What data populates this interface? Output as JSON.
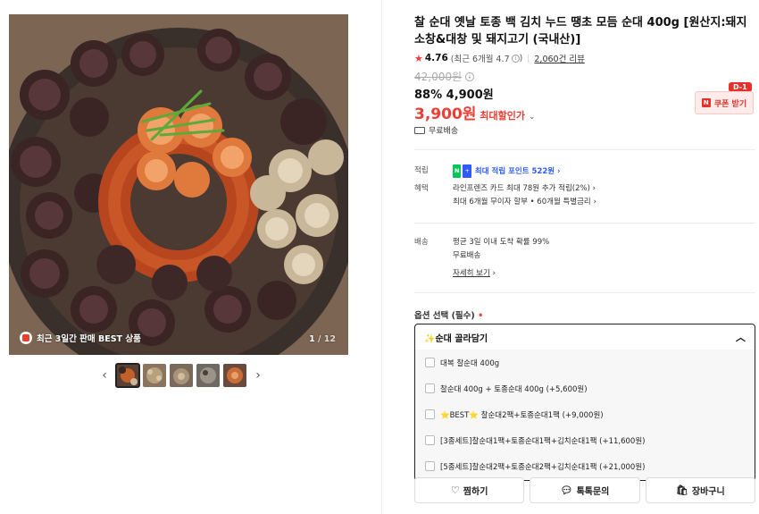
{
  "gallery": {
    "badge_text": "최근 3일간 판매 BEST 상품",
    "counter_current": "1",
    "counter_total": "/ 12",
    "prev_arrow": "‹",
    "next_arrow": "›"
  },
  "product": {
    "title": "찰 순대 옛날 토종 백 김치 누드 땡초 모듬 순대 400g [원산지:돼지소창&대창 및 돼지고기 (국내산)]",
    "rating_score": "4.76",
    "rating_recent": "(최근 6개월 4.7",
    "rating_close": ")",
    "reviews": "2,060건 리뷰",
    "original_price": "42,000원",
    "discount_price": "88% 4,900원",
    "max_price": "3,900원",
    "max_label": "최대할인가",
    "coupon_label": "쿠폰 받기",
    "coupon_badge": "D-1",
    "shipping": "무료배송"
  },
  "benefits": {
    "points_key": "적립",
    "points_value": "최대 적립 포인트 522원",
    "perks_key": "혜택",
    "perk_1": "라인프렌즈 카드 최대 78원 추가 적립(2%)",
    "perk_2": "최대 6개월 무이자 할부 • 60개월 특별금리",
    "delivery_key": "배송",
    "delivery_1": "평균 3일 이내 도착 확률 99%",
    "delivery_2": "무료배송",
    "delivery_more": "자세히 보기"
  },
  "options": {
    "label": "옵션 선택 (필수)",
    "required_mark": "•",
    "selected": "✨순대 골라담기",
    "items": [
      "대복 찰순대 400g",
      "찰순대 400g + 토종순대 400g (+5,600원)",
      "⭐BEST⭐ 찰순대2팩+토종순대1팩 (+9,000원)",
      "[3종세트]찰순대1팩+토종순대1팩+김치순대1팩 (+11,600원)",
      "[5종세트]찰순대2팩+토종순대2팩+김치순대1팩 (+21,000원)"
    ]
  },
  "actions": {
    "wish": "찜하기",
    "talk": "톡톡문의",
    "cart": "장바구니"
  },
  "colors": {
    "accent_red": "#f03c32",
    "point_blue": "#2e5bff",
    "naver_green": "#03c75a"
  }
}
